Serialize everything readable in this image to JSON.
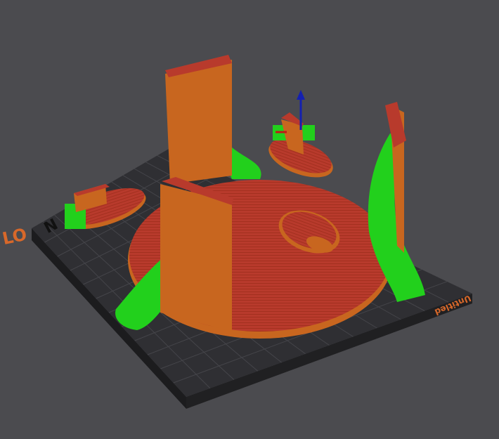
{
  "viewport": {
    "bed_label": "Untitled",
    "side_label": "LO",
    "colors": {
      "background": "#4b4b4f",
      "bed_top": "#2f2f33",
      "bed_side": "#1c1c1e",
      "grid": "#45454a",
      "part_top": "#b83a2c",
      "part_wall": "#c8661f",
      "support": "#22d01c",
      "axis_z": "#1420b0",
      "axis_x": "#c01818"
    }
  }
}
